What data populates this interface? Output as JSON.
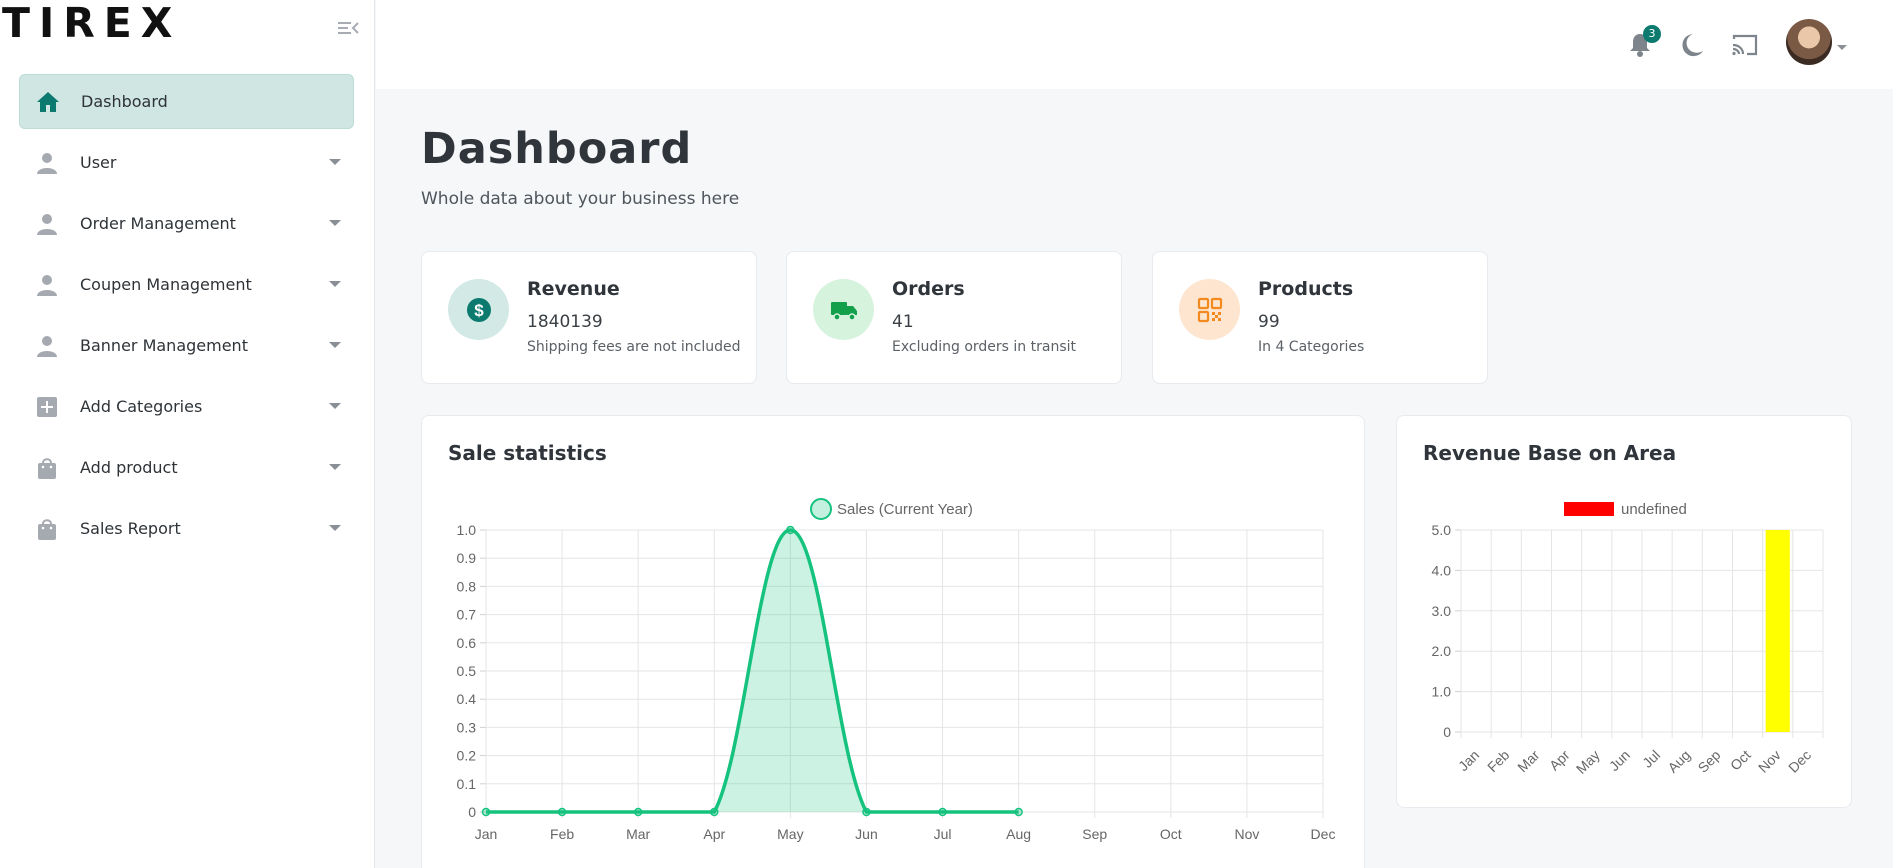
{
  "brand": {
    "logo": "TIREX"
  },
  "sidebar": {
    "items": [
      {
        "label": "Dashboard",
        "icon": "home-icon",
        "active": true
      },
      {
        "label": "User",
        "icon": "user-icon"
      },
      {
        "label": "Order Management",
        "icon": "user-icon"
      },
      {
        "label": "Coupen Management",
        "icon": "user-icon"
      },
      {
        "label": "Banner Management",
        "icon": "user-icon"
      },
      {
        "label": "Add Categories",
        "icon": "plus-square-icon"
      },
      {
        "label": "Add product",
        "icon": "shopping-bag-icon"
      },
      {
        "label": "Sales Report",
        "icon": "shopping-bag-icon"
      }
    ]
  },
  "topbar": {
    "notification_count": "3",
    "icons": [
      "bell-icon",
      "moon-icon",
      "cast-icon",
      "avatar"
    ]
  },
  "header": {
    "title": "Dashboard",
    "subtitle": "Whole data about your business here"
  },
  "stats": [
    {
      "title": "Revenue",
      "value": "1840139",
      "note": "Shipping fees are not included",
      "icon": "dollar-icon",
      "color": "#0c7a6e",
      "bg": "#d3e9e6"
    },
    {
      "title": "Orders",
      "value": "41",
      "note": "Excluding orders in transit",
      "icon": "truck-icon",
      "color": "#13a04a",
      "bg": "#d6f3dd"
    },
    {
      "title": "Products",
      "value": "99",
      "note": "In 4 Categories",
      "icon": "qr-code-icon",
      "color": "#f28a1f",
      "bg": "#fde5cf"
    }
  ],
  "colors": {
    "accent": "#0c7a6e",
    "sales_line": "#15c27e",
    "area_bar": "#ffff00",
    "area_legend": "#ff0000"
  },
  "chart_data": [
    {
      "type": "area",
      "title": "Sale statistics",
      "series": [
        {
          "name": "Sales (Current Year)",
          "values": [
            0,
            0,
            0,
            0,
            1,
            0,
            0,
            0,
            null,
            null,
            null,
            null
          ]
        }
      ],
      "categories": [
        "Jan",
        "Feb",
        "Mar",
        "Apr",
        "May",
        "Jun",
        "Jul",
        "Aug",
        "Sep",
        "Oct",
        "Nov",
        "Dec"
      ],
      "yticks": [
        "0",
        "0.1",
        "0.2",
        "0.3",
        "0.4",
        "0.5",
        "0.6",
        "0.7",
        "0.8",
        "0.9",
        "1.0"
      ],
      "ylim": [
        0,
        1
      ],
      "grid": true,
      "legend": "top"
    },
    {
      "type": "bar",
      "title": "Revenue Base on Area",
      "series": [
        {
          "name": "undefined",
          "values": [
            0,
            0,
            0,
            0,
            0,
            0,
            0,
            0,
            0,
            0,
            5,
            0
          ],
          "colors_note": "bar drawn yellow, legend swatch red"
        }
      ],
      "categories": [
        "Jan",
        "Feb",
        "Mar",
        "Apr",
        "May",
        "Jun",
        "Jul",
        "Aug",
        "Sep",
        "Oct",
        "Nov",
        "Dec"
      ],
      "yticks": [
        "0",
        "1.0",
        "2.0",
        "3.0",
        "4.0",
        "5.0"
      ],
      "ylim": [
        0,
        5
      ],
      "grid": true,
      "legend": "top"
    }
  ]
}
